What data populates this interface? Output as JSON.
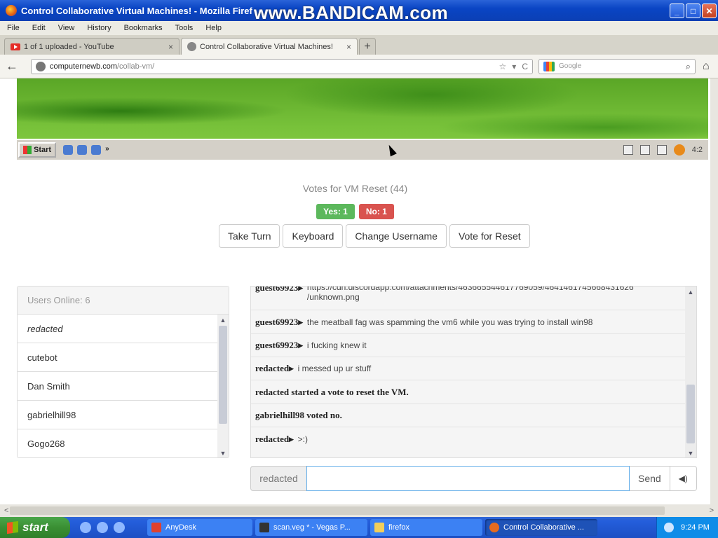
{
  "window": {
    "title": "Control Collaborative Virtual Machines! - Mozilla Firef",
    "watermark": "www.BANDICAM.com",
    "buttons": {
      "minimize": "_",
      "maximize": "□",
      "close": "✕"
    }
  },
  "menu": [
    "File",
    "Edit",
    "View",
    "History",
    "Bookmarks",
    "Tools",
    "Help"
  ],
  "tabs": [
    {
      "label": "1 of 1 uploaded - YouTube",
      "icon": "youtube-icon",
      "close": "×"
    },
    {
      "label": "Control Collaborative Virtual Machines!",
      "icon": "page-icon",
      "close": "×"
    }
  ],
  "newtab": "+",
  "nav": {
    "back": "←",
    "url_host": "computernewb.com",
    "url_path": "/collab-vm/",
    "star": "☆",
    "dropdown": "▾",
    "reload": "C",
    "search_placeholder": "Google",
    "search_icon": "⌕",
    "home": "⌂"
  },
  "vm": {
    "start_label": "Start",
    "quick_more": "»",
    "clock": "4:2"
  },
  "votes": {
    "title": "Votes for VM Reset (44)",
    "yes": "Yes: 1",
    "no": "No: 1"
  },
  "actions": [
    "Take Turn",
    "Keyboard",
    "Change Username",
    "Vote for Reset"
  ],
  "users": {
    "header": "Users Online: 6",
    "list": [
      "redacted",
      "cutebot",
      "Dan Smith",
      "gabrielhill98",
      "Gogo268"
    ]
  },
  "chat": {
    "messages": [
      {
        "user": "guest69923▸",
        "text": "https://cdn.discordapp.com/attachments/463665544617769059/4641461745668431626 /unknown.png",
        "system": false
      },
      {
        "user": "guest69923▸",
        "text": "the meatball fag was spamming the vm6 while you was trying to install win98",
        "system": false
      },
      {
        "user": "guest69923▸",
        "text": "i fucking knew it",
        "system": false
      },
      {
        "user": "redacted▸",
        "text": "i messed up ur stuff",
        "system": false
      },
      {
        "user": "",
        "text": "redacted started a vote to reset the VM.",
        "system": true
      },
      {
        "user": "",
        "text": "gabrielhill98 voted no.",
        "system": true
      },
      {
        "user": "redacted▸",
        "text": ">:)",
        "system": false
      }
    ],
    "username": "redacted",
    "input_value": "",
    "send": "Send",
    "sound": "◀)"
  },
  "taskbar": {
    "start": "start",
    "items": [
      {
        "label": "AnyDesk",
        "active": false
      },
      {
        "label": "scan.veg * - Vegas P...",
        "active": false
      },
      {
        "label": "firefox",
        "active": false
      },
      {
        "label": "Control Collaborative ...",
        "active": true
      }
    ],
    "clock": "9:24 PM"
  },
  "scroll": {
    "left": "<",
    "right": ">",
    "up": "▲",
    "down": "▼"
  }
}
